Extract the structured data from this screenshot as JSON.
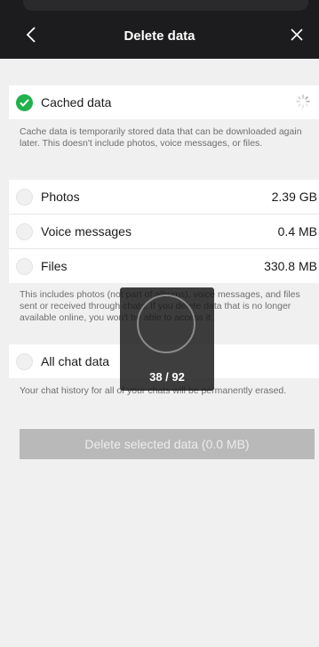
{
  "header": {
    "title": "Delete data",
    "back_icon": "chevron-left-icon",
    "close_icon": "close-icon"
  },
  "cached": {
    "label": "Cached data",
    "checked": true,
    "description": "Cache data is temporarily stored data that can be downloaded again later. This doesn't include photos, voice messages, or files."
  },
  "items": [
    {
      "label": "Photos",
      "value": "2.39 GB",
      "checked": false
    },
    {
      "label": "Voice messages",
      "value": "0.4 MB",
      "checked": false
    },
    {
      "label": "Files",
      "value": "330.8 MB",
      "checked": false
    }
  ],
  "media_description": "This includes photos (not part of albums), voice messages, and files sent or received through chats. If you delete data that is no longer available online, you won't be able to access it.",
  "chat": {
    "label": "All chat data",
    "checked": false,
    "description": "Your chat history for all of your chats will be permanently erased."
  },
  "delete_button": {
    "label": "Delete selected data (0.0 MB)"
  },
  "progress_overlay": {
    "count": "38 / 92"
  },
  "colors": {
    "header_bg": "#1c1c1e",
    "check_green": "#22b14c",
    "disabled_button": "#b9b9b9",
    "background": "#f0f0f0"
  }
}
